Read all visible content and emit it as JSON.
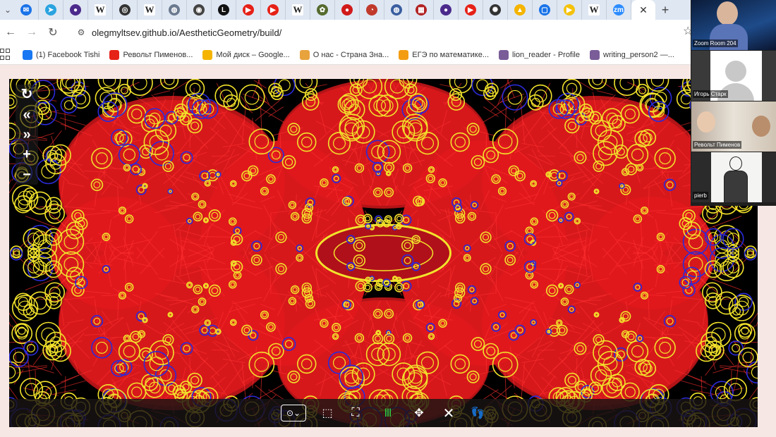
{
  "browser": {
    "tabs": [
      {
        "icon": "mail-icon",
        "color": "#1a73e8",
        "glyph": "✉"
      },
      {
        "icon": "telegram-icon",
        "color": "#2aa3df",
        "glyph": "➤"
      },
      {
        "icon": "app-icon",
        "color": "#4b2a8c",
        "glyph": "●"
      },
      {
        "icon": "wikipedia-icon",
        "color": "#ffffff",
        "glyph": "W"
      },
      {
        "icon": "app-icon",
        "color": "#333333",
        "glyph": "◎"
      },
      {
        "icon": "wikipedia-icon",
        "color": "#ffffff",
        "glyph": "W"
      },
      {
        "icon": "app-icon",
        "color": "#6b7a8f",
        "glyph": "◍"
      },
      {
        "icon": "app-icon",
        "color": "#444444",
        "glyph": "◉"
      },
      {
        "icon": "lichess-icon",
        "color": "#111111",
        "glyph": "L"
      },
      {
        "icon": "youtube-icon",
        "color": "#e62117",
        "glyph": "▶"
      },
      {
        "icon": "youtube-icon",
        "color": "#e62117",
        "glyph": "▶"
      },
      {
        "icon": "wikipedia-icon",
        "color": "#ffffff",
        "glyph": "W"
      },
      {
        "icon": "app-icon",
        "color": "#556b2f",
        "glyph": "✿"
      },
      {
        "icon": "app-icon",
        "color": "#d11a1a",
        "glyph": "●"
      },
      {
        "icon": "app-icon",
        "color": "#c0392b",
        "glyph": "◔"
      },
      {
        "icon": "app-icon",
        "color": "#3a5fa0",
        "glyph": "◍"
      },
      {
        "icon": "checker-icon",
        "color": "#b22222",
        "glyph": "▦"
      },
      {
        "icon": "app-icon",
        "color": "#4b2a8c",
        "glyph": "●"
      },
      {
        "icon": "youtube-icon",
        "color": "#e62117",
        "glyph": "▶"
      },
      {
        "icon": "app-icon",
        "color": "#333333",
        "glyph": "✺"
      },
      {
        "icon": "drive-icon",
        "color": "#f4b400",
        "glyph": "▲"
      },
      {
        "icon": "chat-icon",
        "color": "#1a73e8",
        "glyph": "▢"
      },
      {
        "icon": "app-icon",
        "color": "#f4c20d",
        "glyph": "▶"
      },
      {
        "icon": "wikipedia-icon",
        "color": "#ffffff",
        "glyph": "W"
      },
      {
        "icon": "zoom-icon",
        "color": "#2d8cff",
        "glyph": "zm"
      }
    ],
    "active_tab_close": "✕",
    "new_tab": "+",
    "url": "olegmyltsev.github.io/AestheticGeometry/build/",
    "bookmarks": [
      {
        "label": "(1) Facebook Tishi",
        "color": "#1877f2"
      },
      {
        "label": "Револьт Пименов...",
        "color": "#e62117"
      },
      {
        "label": "Мой диск – Google...",
        "color": "#f4b400"
      },
      {
        "label": "О нас - Страна Зна...",
        "color": "#e8a33d"
      },
      {
        "label": "ЕГЭ по математике...",
        "color": "#f39c12"
      },
      {
        "label": "lion_reader - Profile",
        "color": "#7a5c99"
      },
      {
        "label": "writing_person2 —...",
        "color": "#7a5c99"
      }
    ]
  },
  "canvas": {
    "side_controls": [
      "↻",
      "«",
      "»",
      "+",
      "−"
    ],
    "bottom_controls": [
      "⊙⌄",
      "⬚",
      "⛶",
      "Ⅲ",
      "✥",
      "✕",
      "👣"
    ],
    "colors": {
      "petal": "#e0191e",
      "ring": "#f2e32b",
      "ring_alt": "#2b2bd9",
      "background": "#000000"
    }
  },
  "video_call": {
    "participants": [
      {
        "name": "Zoom Room 204"
      },
      {
        "name": "Игорь Старк"
      },
      {
        "name": "Револьт Пименов"
      },
      {
        "name": "pierb"
      }
    ]
  }
}
